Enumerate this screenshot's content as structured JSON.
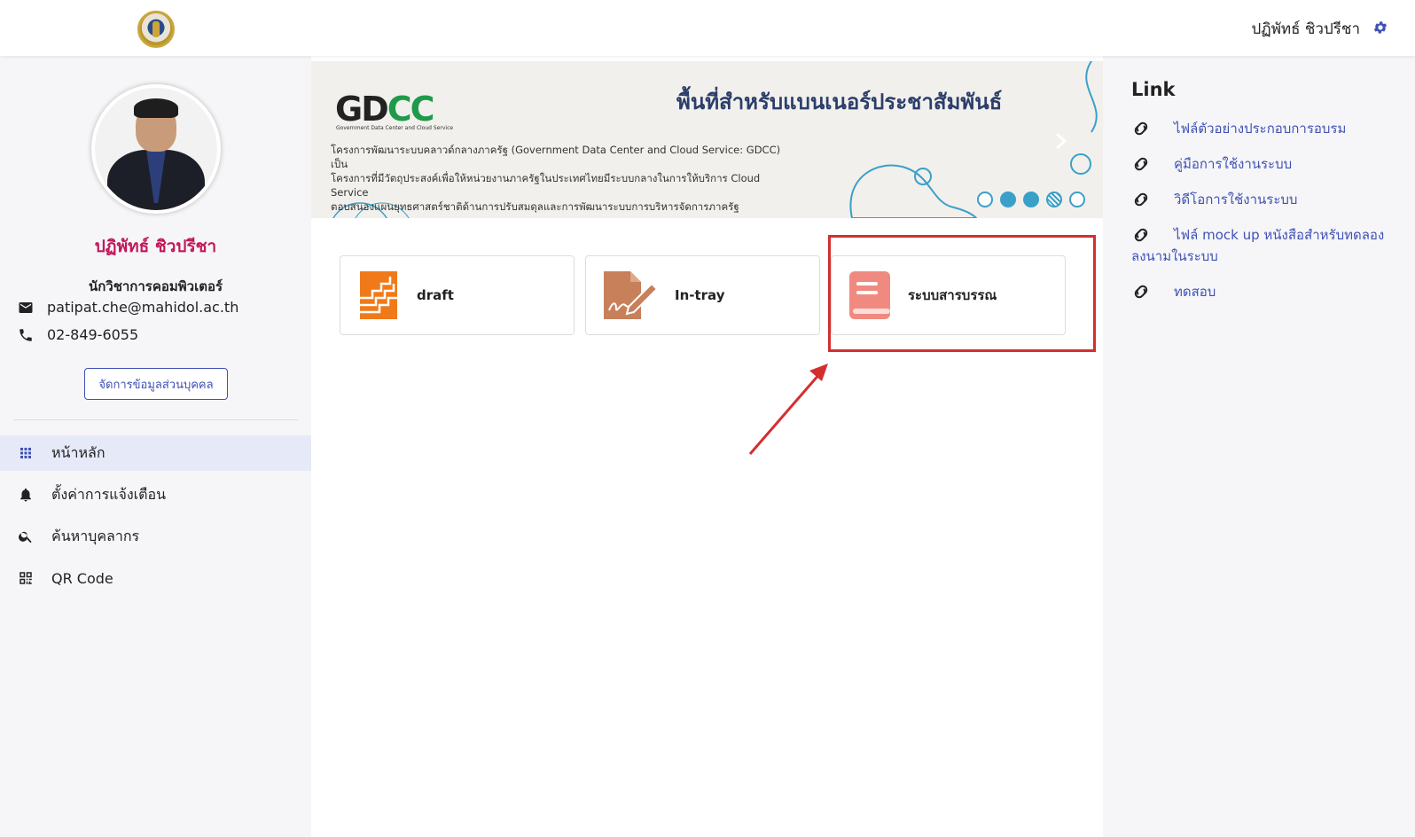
{
  "header": {
    "user_name": "ปฏิพัทธ์ ชิวปรีชา",
    "logo_icon": "university-seal",
    "settings_icon": "gear-icon",
    "accent": "#3f51b5"
  },
  "profile": {
    "name": "ปฏิพัทธ์ ชิวปรีชา",
    "role": "นักวิชาการคอมพิวเตอร์",
    "email": "patipat.che@mahidol.ac.th",
    "phone": "02-849-6055",
    "manage_button": "จัดการข้อมูลส่วนบุคคล",
    "name_color": "#c2185b"
  },
  "nav": {
    "items": [
      {
        "label": "หน้าหลัก",
        "icon": "apps-grid-icon",
        "active": true
      },
      {
        "label": "ตั้งค่าการแจ้งเตือน",
        "icon": "bell-icon",
        "active": false
      },
      {
        "label": "ค้นหาบุคลากร",
        "icon": "search-icon",
        "active": false
      },
      {
        "label": "QR Code",
        "icon": "qr-code-icon",
        "active": false
      }
    ]
  },
  "banner": {
    "logo": "GDCC",
    "logo_caption": "Government Data Center and Cloud Service",
    "title": "พื้นที่สำหรับแบนเนอร์ประชาสัมพันธ์",
    "desc_lines": [
      "โครงการพัฒนาระบบคลาวด์กลางภาครัฐ (Government Data Center and Cloud Service: GDCC) เป็น",
      "โครงการที่มีวัตถุประสงค์เพื่อให้หน่วยงานภาครัฐในประเทศไทยมีระบบกลางในการให้บริการ Cloud Service",
      "ตอบสนองแผนยุทธศาสตร์ชาติด้านการปรับสมดุลและการพัฒนาระบบการบริหารจัดการภาครัฐ"
    ],
    "slide_count": 5,
    "active_slide": 2
  },
  "cards": [
    {
      "label": "draft",
      "icon": "draft-stack-icon",
      "color": "#f07a1a"
    },
    {
      "label": "In-tray",
      "icon": "signature-pen-icon",
      "color": "#c7805a"
    },
    {
      "label": "ระบบสารบรรณ",
      "icon": "book-icon",
      "color": "#f08a80"
    }
  ],
  "links": {
    "title": "Link",
    "items": [
      "ไฟล์ตัวอย่างประกอบการอบรม",
      "คู่มือการใช้งานระบบ",
      "วิดีโอการใช้งานระบบ",
      "ไฟล์ mock up หนังสือสำหรับทดลองลงนามในระบบ",
      "ทดสอบ"
    ]
  },
  "annotation_color": "#d32f2f"
}
